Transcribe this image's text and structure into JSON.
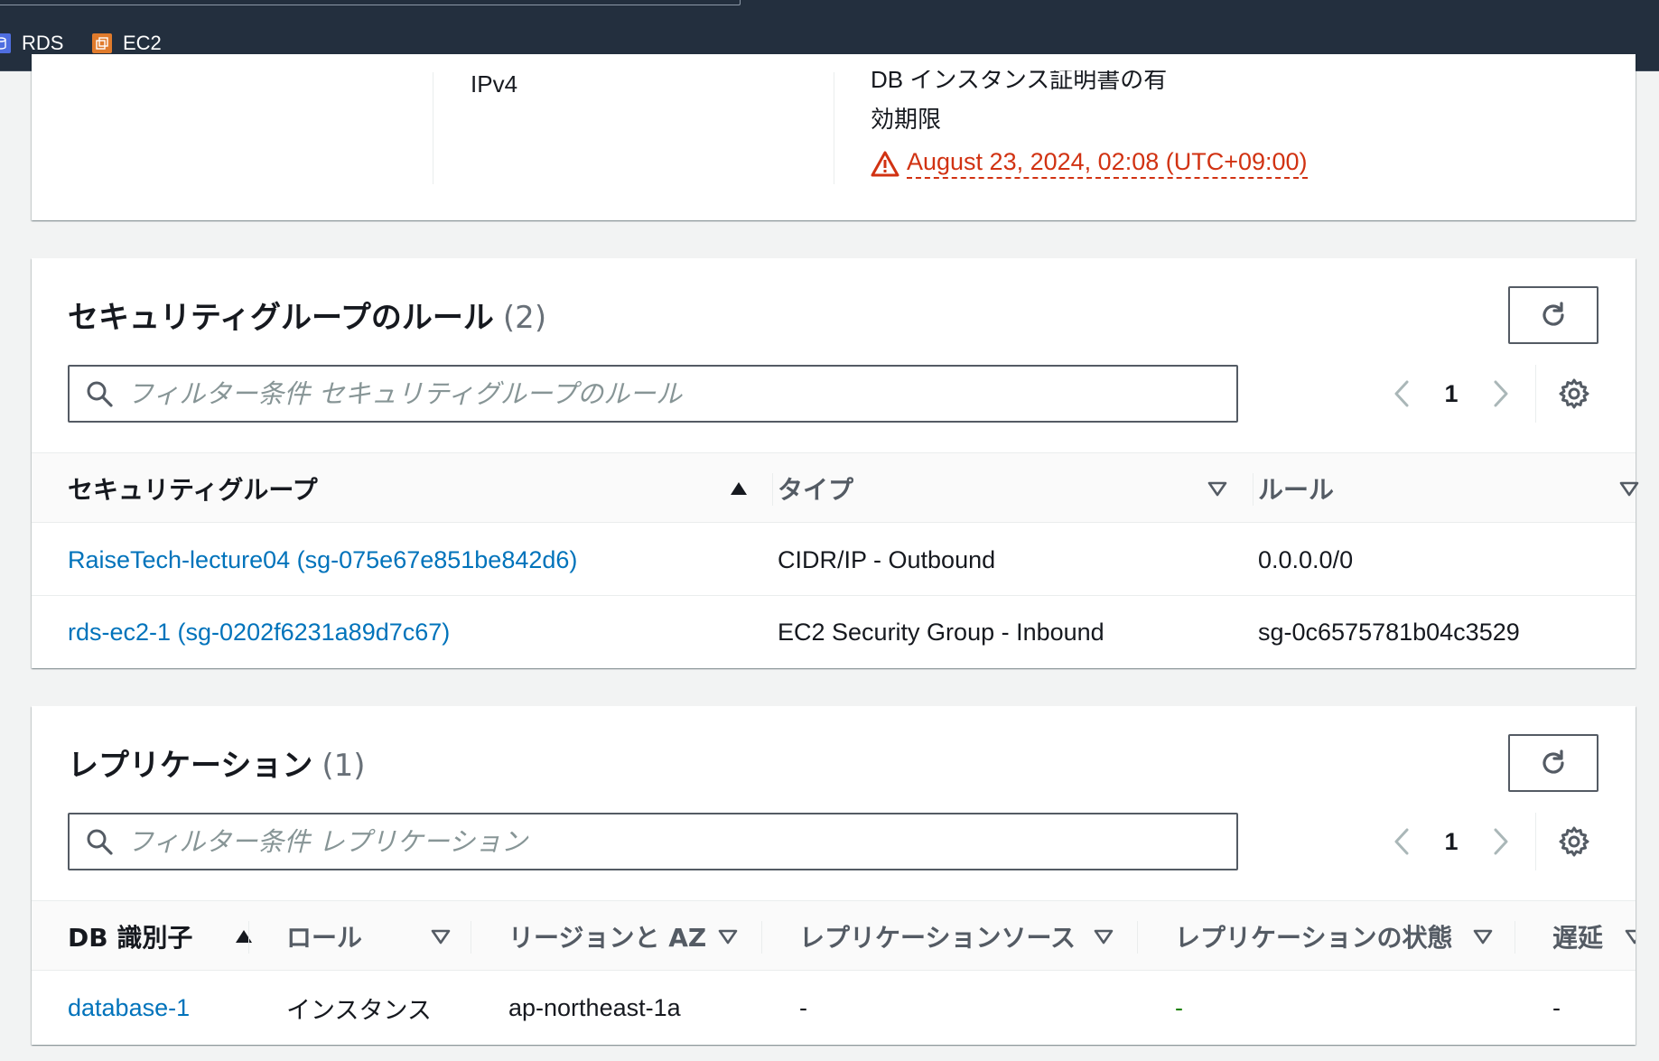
{
  "nav": {
    "favorites": [
      {
        "label": "RDS",
        "icon": "rds-icon"
      },
      {
        "label": "EC2",
        "icon": "ec2-icon"
      }
    ]
  },
  "details": {
    "ip_type_value": "IPv4",
    "cert_expiry_label_line1": "DB インスタンス証明書の有",
    "cert_expiry_label_line2": "効期限",
    "cert_expiry_value": "August 23, 2024, 02:08 (UTC+09:00)",
    "warning_icon": "warning-triangle-icon"
  },
  "security_rules": {
    "title": "セキュリティグループのルール",
    "count": "(2)",
    "filter_placeholder": "フィルター条件 セキュリティグループのルール",
    "page": "1",
    "columns": [
      "セキュリティグループ",
      "タイプ",
      "ルール"
    ],
    "rows": [
      {
        "group": "RaiseTech-lecture04 (sg-075e67e851be842d6)",
        "type": "CIDR/IP - Outbound",
        "rule": "0.0.0.0/0"
      },
      {
        "group": "rds-ec2-1 (sg-0202f6231a89d7c67)",
        "type": "EC2 Security Group - Inbound",
        "rule": "sg-0c6575781b04c3529"
      }
    ]
  },
  "replication": {
    "title": "レプリケーション",
    "count": "(1)",
    "filter_placeholder": "フィルター条件 レプリケーション",
    "page": "1",
    "columns": [
      "DB 識別子",
      "ロール",
      "リージョンと AZ",
      "レプリケーションソース",
      "レプリケーションの状態",
      "遅延"
    ],
    "rows": [
      {
        "db_id": "database-1",
        "role": "インスタンス",
        "region_az": "ap-northeast-1a",
        "source": "-",
        "state": "-",
        "lag": "-"
      }
    ]
  },
  "colors": {
    "nav_bg": "#232f3e",
    "link": "#0073bb",
    "warning": "#d13212",
    "success": "#1d8102",
    "page_bg": "#f2f3f3"
  }
}
